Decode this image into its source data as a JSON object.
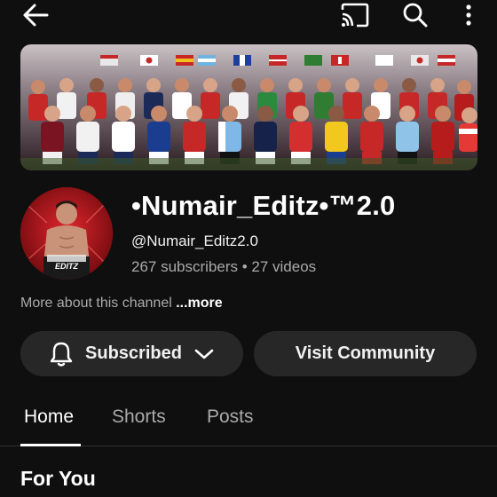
{
  "topbar": {
    "icons": [
      "back-arrow-icon",
      "cast-icon",
      "search-icon",
      "more-vert-icon"
    ]
  },
  "banner": {
    "description_icon": "football-players-banner-image"
  },
  "channel": {
    "name": "•Numair_Editz•™2.0",
    "handle": "@Numair_Editz2.0",
    "stats": "267 subscribers • 27 videos",
    "about_text": "More about this channel ",
    "about_more": "...more",
    "avatar_text": "EDITZ"
  },
  "actions": {
    "subscribed_label": "Subscribed",
    "visit_label": "Visit Community"
  },
  "tabs": [
    {
      "label": "Home",
      "active": true
    },
    {
      "label": "Shorts",
      "active": false
    },
    {
      "label": "Posts",
      "active": false
    }
  ],
  "section": {
    "title": "For You"
  },
  "colors": {
    "background": "#0f0f0f",
    "button_bg": "#272727",
    "secondary_text": "#aaaaaa",
    "avatar_red": "#b01218"
  }
}
